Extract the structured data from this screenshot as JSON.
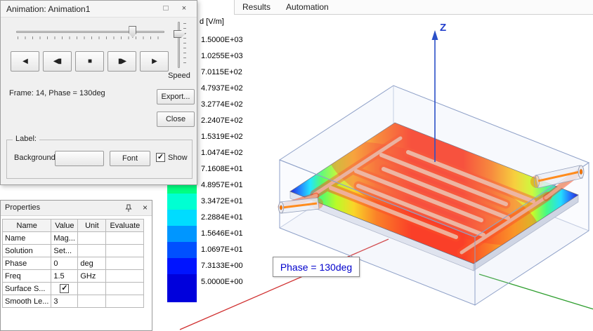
{
  "menu": {
    "items": [
      "Results",
      "Automation"
    ]
  },
  "animation_dialog": {
    "title": "Animation: Animation1",
    "frame_status": "Frame: 14, Phase = 130deg",
    "speed_label": "Speed",
    "export_button": "Export...",
    "close_button": "Close",
    "playback": [
      {
        "name": "play-reverse-button",
        "glyph": "◀"
      },
      {
        "name": "step-back-button",
        "glyph": "◀▮"
      },
      {
        "name": "stop-button",
        "glyph": "■"
      },
      {
        "name": "step-forward-button",
        "glyph": "▮▶"
      },
      {
        "name": "play-forward-button",
        "glyph": "▶"
      }
    ],
    "label_group": {
      "title": "Label:",
      "background_label": "Background:",
      "font_button": "Font",
      "show_checkbox_label": "Show",
      "show_checked": true
    }
  },
  "properties_panel": {
    "title": "Properties",
    "columns": [
      "Name",
      "Value",
      "Unit",
      "Evaluate"
    ],
    "rows": [
      {
        "name": "Name",
        "value": "Mag...",
        "unit": "",
        "evaluate": "",
        "type": "text"
      },
      {
        "name": "Solution",
        "value": "Set...",
        "unit": "",
        "evaluate": "",
        "type": "text"
      },
      {
        "name": "Phase",
        "value": "0",
        "unit": "deg",
        "evaluate": "",
        "type": "text"
      },
      {
        "name": "Freq",
        "value": "1.5",
        "unit": "GHz",
        "evaluate": "",
        "type": "text"
      },
      {
        "name": "Surface S...",
        "value": true,
        "unit": "",
        "evaluate": "",
        "type": "checkbox"
      },
      {
        "name": "Smooth Le...",
        "value": "3",
        "unit": "",
        "evaluate": "",
        "type": "text"
      }
    ]
  },
  "legend": {
    "title": "d [V/m]",
    "entries": [
      {
        "value": "1.5000E+03",
        "color": "#FF0000"
      },
      {
        "value": "1.0255E+03",
        "color": "#FF4B00"
      },
      {
        "value": "7.0115E+02",
        "color": "#FF7D00"
      },
      {
        "value": "4.7937E+02",
        "color": "#FFAF00"
      },
      {
        "value": "3.2774E+02",
        "color": "#FFE100"
      },
      {
        "value": "2.2407E+02",
        "color": "#D2FF00"
      },
      {
        "value": "1.5319E+02",
        "color": "#8CFF00"
      },
      {
        "value": "1.0474E+02",
        "color": "#46FF00"
      },
      {
        "value": "7.1608E+01",
        "color": "#00FF32"
      },
      {
        "value": "4.8957E+01",
        "color": "#00FF82"
      },
      {
        "value": "3.3472E+01",
        "color": "#00FFD2"
      },
      {
        "value": "2.2884E+01",
        "color": "#00DCFF"
      },
      {
        "value": "1.5646E+01",
        "color": "#0096FF"
      },
      {
        "value": "1.0697E+01",
        "color": "#0050FF"
      },
      {
        "value": "7.3133E+00",
        "color": "#0014FF"
      },
      {
        "value": "5.0000E+00",
        "color": "#0000DC"
      }
    ]
  },
  "viewport": {
    "phase_annotation": "Phase = 130deg",
    "z_axis_label": "Z",
    "axis_colors": {
      "z": "#2b50c8",
      "red_axis": "#d03030",
      "green_axis": "#2f9e2f"
    }
  }
}
